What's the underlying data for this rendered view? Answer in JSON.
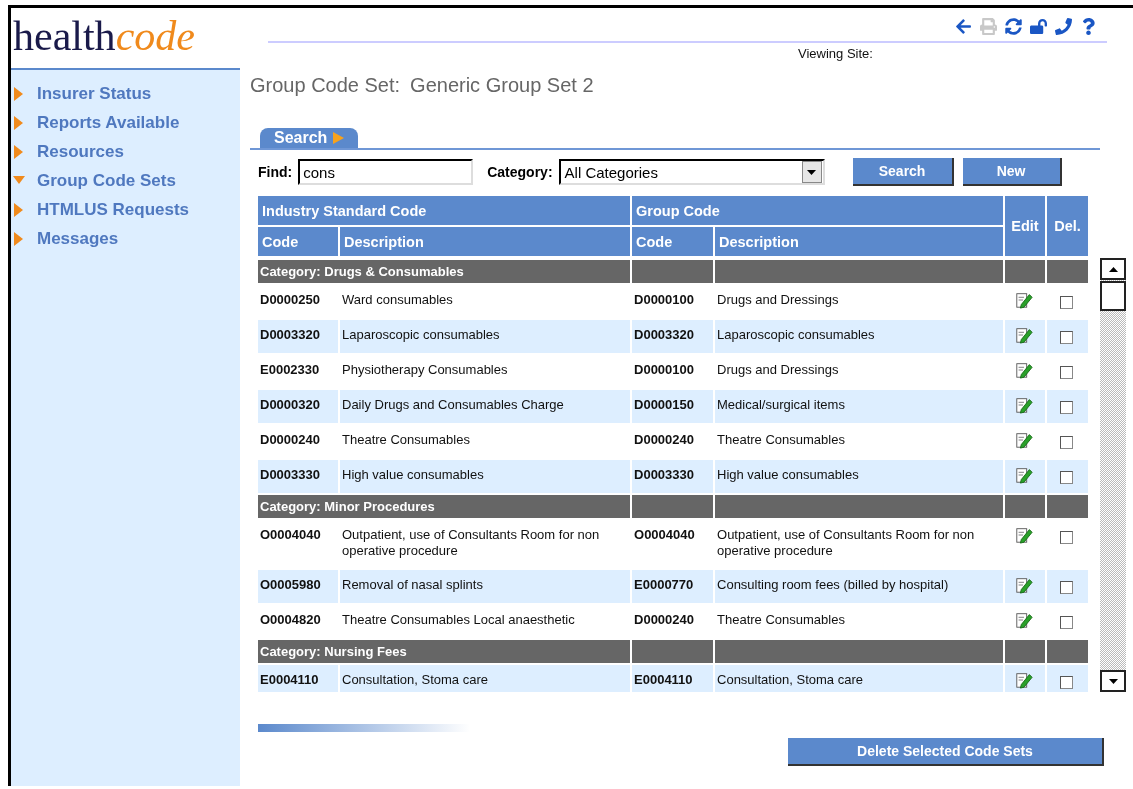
{
  "logo": {
    "first": "health",
    "second": "code"
  },
  "toolbar": [
    {
      "kind": "back",
      "disabled": false
    },
    {
      "kind": "print",
      "disabled": true
    },
    {
      "kind": "refresh",
      "disabled": false
    },
    {
      "kind": "unlock",
      "disabled": false
    },
    {
      "kind": "phone",
      "disabled": false
    },
    {
      "kind": "help",
      "disabled": false
    }
  ],
  "viewing_site": "Viewing Site:",
  "page_title": {
    "label": "Group Code Set:",
    "value": "Generic Group Set 2"
  },
  "sidebar": {
    "items": [
      {
        "label": "Insurer Status",
        "expanded": false
      },
      {
        "label": "Reports Available",
        "expanded": false
      },
      {
        "label": "Resources",
        "expanded": false
      },
      {
        "label": "Group Code Sets",
        "expanded": true
      },
      {
        "label": "HTMLUS Requests",
        "expanded": false
      },
      {
        "label": "Messages",
        "expanded": false
      }
    ]
  },
  "search_tab": {
    "label": "Search"
  },
  "filters": {
    "find_label": "Find:",
    "find_value": "cons",
    "category_label": "Category:",
    "category_value": "All Categories"
  },
  "buttons": {
    "search": "Search",
    "new": "New",
    "delete": "Delete Selected Code Sets"
  },
  "table": {
    "group_headers": [
      "Industry Standard Code",
      "Group Code"
    ],
    "columns": [
      "Code",
      "Description",
      "Code",
      "Description"
    ],
    "edit_header": "Edit",
    "delete_header": "Del.",
    "rows": [
      {
        "kind": "category",
        "label": "Category: Drugs & Consumables"
      },
      {
        "kind": "item",
        "industry_code": "D0000250",
        "industry_description": "Ward consumables",
        "group_code": "D0000100",
        "group_description": "Drugs and Dressings",
        "delete_checked": false
      },
      {
        "kind": "item",
        "industry_code": "D0003320",
        "industry_description": "Laparoscopic consumables",
        "group_code": "D0003320",
        "group_description": "Laparoscopic consumables",
        "delete_checked": false
      },
      {
        "kind": "item",
        "industry_code": "E0002330",
        "industry_description": "Physiotherapy Consumables",
        "group_code": "D0000100",
        "group_description": "Drugs and Dressings",
        "delete_checked": false
      },
      {
        "kind": "item",
        "industry_code": "D0000320",
        "industry_description": "Daily Drugs and Consumables Charge",
        "group_code": "D0000150",
        "group_description": "Medical/surgical items",
        "delete_checked": false
      },
      {
        "kind": "item",
        "industry_code": "D0000240",
        "industry_description": "Theatre Consumables",
        "group_code": "D0000240",
        "group_description": "Theatre Consumables",
        "delete_checked": false
      },
      {
        "kind": "item",
        "industry_code": "D0003330",
        "industry_description": "High value consumables",
        "group_code": "D0003330",
        "group_description": "High value consumables",
        "delete_checked": false
      },
      {
        "kind": "category",
        "label": "Category: Minor Procedures"
      },
      {
        "kind": "item",
        "industry_code": "O0004040",
        "industry_description": "Outpatient, use of Consultants Room for non operative procedure",
        "group_code": "O0004040",
        "group_description": "Outpatient, use of Consultants Room for non operative procedure",
        "delete_checked": false
      },
      {
        "kind": "item",
        "industry_code": "O0005980",
        "industry_description": "Removal of nasal splints",
        "group_code": "E0000770",
        "group_description": "Consulting room fees (billed by hospital)",
        "delete_checked": false
      },
      {
        "kind": "item",
        "industry_code": "O0004820",
        "industry_description": "Theatre Consumables Local anaesthetic",
        "group_code": "D0000240",
        "group_description": "Theatre Consumables",
        "delete_checked": false
      },
      {
        "kind": "category",
        "label": "Category: Nursing Fees"
      },
      {
        "kind": "item",
        "industry_code": "E0004110",
        "industry_description": "Consultation, Stoma care",
        "group_code": "E0004110",
        "group_description": "Consultation, Stoma care",
        "delete_checked": false
      }
    ]
  }
}
